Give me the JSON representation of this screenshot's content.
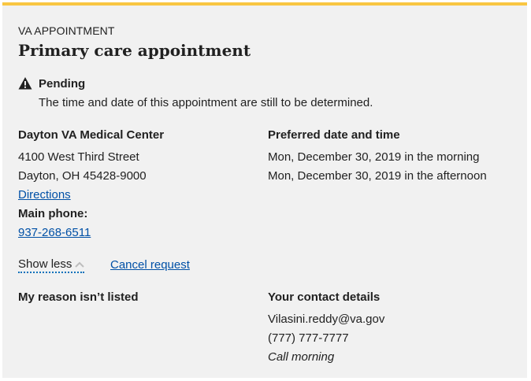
{
  "card": {
    "eyebrow": "VA APPOINTMENT",
    "title": "Primary care appointment",
    "status": {
      "icon": "warning-icon",
      "label": "Pending",
      "message": "The time and date of this appointment are still to be determined."
    },
    "facility": {
      "name": "Dayton VA Medical Center",
      "address_line1": "4100 West Third Street",
      "address_line2": "Dayton, OH 45428-9000",
      "directions_label": "Directions",
      "phone_heading": "Main phone:",
      "phone": "937-268-6511"
    },
    "preferred": {
      "heading": "Preferred date and time",
      "times": [
        "Mon, December 30, 2019 in the morning",
        "Mon, December 30, 2019 in the afternoon"
      ]
    },
    "actions": {
      "show_less_label": "Show less",
      "cancel_label": "Cancel request"
    },
    "reason": {
      "heading": "My reason isn’t listed"
    },
    "contact": {
      "heading": "Your contact details",
      "email": "Vilasini.reddy@va.gov",
      "phone": "(777) 777-7777",
      "preference": "Call morning"
    }
  },
  "colors": {
    "accent_border": "#f9c642",
    "card_background": "#f1f1f1",
    "link": "#0050a6",
    "text": "#212121"
  }
}
